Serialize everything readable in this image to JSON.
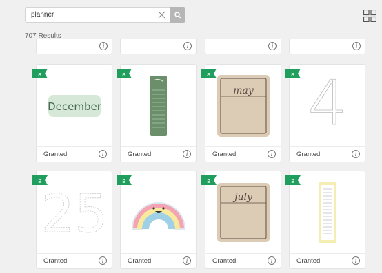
{
  "search": {
    "value": "planner",
    "placeholder": ""
  },
  "results_text": "707 Results",
  "cards": [
    {
      "name": "december-card",
      "status": "Granted",
      "image": "december"
    },
    {
      "name": "vertical-list-card",
      "status": "Granted",
      "image": "green-list"
    },
    {
      "name": "may-card",
      "status": "Granted",
      "image": "may"
    },
    {
      "name": "four-card",
      "status": "Granted",
      "image": "four"
    },
    {
      "name": "twenty-five-card",
      "status": "Granted",
      "image": "twenty-five"
    },
    {
      "name": "rainbow-card",
      "status": "Granted",
      "image": "rainbow"
    },
    {
      "name": "july-card",
      "status": "Granted",
      "image": "july"
    },
    {
      "name": "yellow-list-card",
      "status": "Granted",
      "image": "yellow-list"
    }
  ],
  "sticker_text": {
    "december": "December",
    "may": "may",
    "july": "july",
    "four": "4",
    "twenty_five": "25"
  },
  "icons": {
    "search": "search-icon",
    "clear": "close-icon",
    "grid": "grid-view-icon",
    "info": "info-icon",
    "flag": "green-flag-icon"
  },
  "colors": {
    "flag": "#1f9e5e",
    "search_button": "#b6b6b6"
  }
}
